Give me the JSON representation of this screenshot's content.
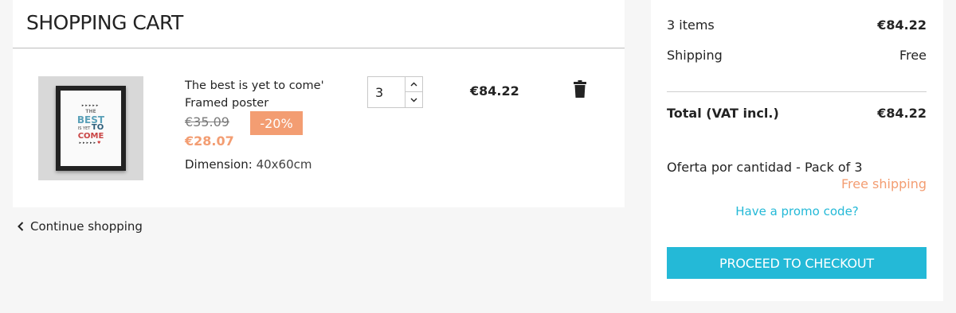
{
  "cart": {
    "title": "SHOPPING CART",
    "product": {
      "name": "The best is yet to come' Framed poster",
      "regular_price": "€35.09",
      "discount": "-20%",
      "price": "€28.07",
      "dimension_label": "Dimension:",
      "dimension_value": "40x60cm",
      "quantity": "3",
      "line_total": "€84.22",
      "poster": {
        "the": "THE",
        "best": "BEST",
        "is_yet": "IS YET",
        "to": "TO",
        "come": "COME"
      }
    },
    "continue_label": "Continue shopping"
  },
  "summary": {
    "items_label": "3 items",
    "items_value": "€84.22",
    "shipping_label": "Shipping",
    "shipping_value": "Free",
    "total_label": "Total (VAT incl.)",
    "total_value": "€84.22",
    "offer_label": "Oferta por cantidad - Pack of 3",
    "offer_value": "Free shipping",
    "promo_label": "Have a promo code?",
    "checkout_label": "PROCEED TO CHECKOUT"
  },
  "colors": {
    "accent": "#24b9d7",
    "discount": "#f39d72",
    "background": "#f6f6f6"
  },
  "icons": [
    "trash-icon",
    "chevron-left-icon",
    "chevron-up-icon",
    "chevron-down-icon"
  ]
}
